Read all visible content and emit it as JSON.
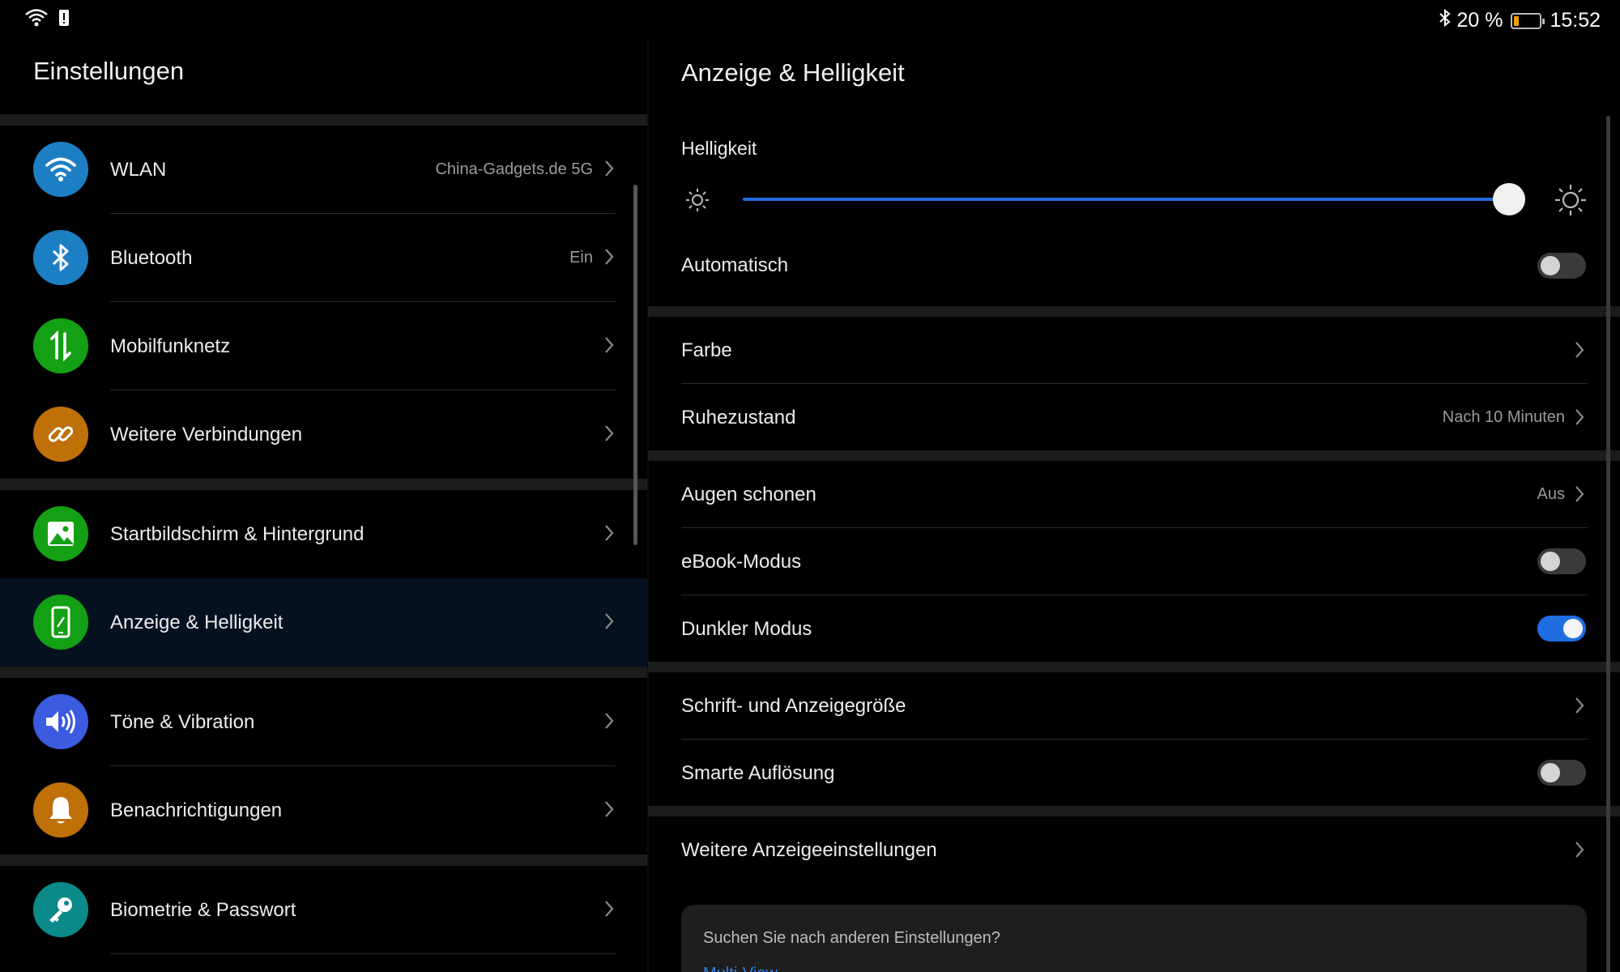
{
  "status_bar": {
    "time": "15:52",
    "battery_percent": "20 %",
    "battery_level": 0.2,
    "icons": [
      "wifi-icon",
      "notification-alert-icon",
      "bluetooth-icon",
      "battery-icon"
    ]
  },
  "left": {
    "title": "Einstellungen",
    "items": [
      {
        "label": "WLAN",
        "value": "China-Gadgets.de 5G",
        "icon": "wifi-icon",
        "color": "#1c7fc4"
      },
      {
        "label": "Bluetooth",
        "value": "Ein",
        "icon": "bluetooth-icon",
        "color": "#1c7fc4"
      },
      {
        "label": "Mobilfunknetz",
        "value": "",
        "icon": "mobile-data-icon",
        "color": "#14a014"
      },
      {
        "label": "Weitere Verbindungen",
        "value": "",
        "icon": "link-icon",
        "color": "#c07008"
      },
      {
        "label": "Startbildschirm & Hintergrund",
        "value": "",
        "icon": "image-icon",
        "color": "#14a014"
      },
      {
        "label": "Anzeige & Helligkeit",
        "value": "",
        "icon": "phone-brightness-icon",
        "color": "#14a014"
      },
      {
        "label": "Töne & Vibration",
        "value": "",
        "icon": "speaker-icon",
        "color": "#3b5be0"
      },
      {
        "label": "Benachrichtigungen",
        "value": "",
        "icon": "bell-icon",
        "color": "#c07008"
      },
      {
        "label": "Biometrie & Passwort",
        "value": "",
        "icon": "key-icon",
        "color": "#0c8a8a"
      }
    ]
  },
  "right": {
    "title": "Anzeige & Helligkeit",
    "brightness_label": "Helligkeit",
    "brightness_level": 0.98,
    "automatisch": {
      "label": "Automatisch",
      "on": false
    },
    "farbe": {
      "label": "Farbe"
    },
    "ruhezustand": {
      "label": "Ruhezustand",
      "value": "Nach 10 Minuten"
    },
    "augen": {
      "label": "Augen schonen",
      "value": "Aus"
    },
    "ebook": {
      "label": "eBook-Modus",
      "on": false
    },
    "dunkel": {
      "label": "Dunkler Modus",
      "on": true
    },
    "schrift": {
      "label": "Schrift- und Anzeigegröße"
    },
    "smart": {
      "label": "Smarte Auflösung",
      "on": false
    },
    "weitere": {
      "label": "Weitere Anzeigeeinstellungen"
    },
    "search": {
      "question": "Suchen Sie nach anderen Einstellungen?",
      "link": "Multi-View"
    },
    "colors": {
      "accent": "#1f6de0",
      "link": "#2f7fe8"
    }
  }
}
